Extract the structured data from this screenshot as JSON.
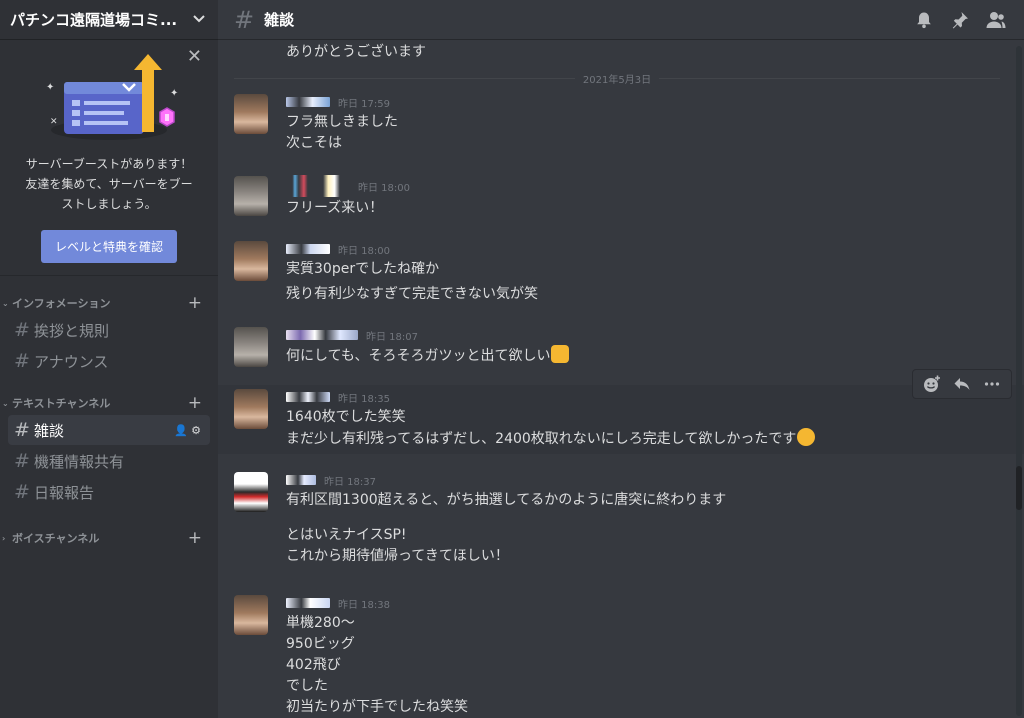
{
  "server": {
    "name": "パチンコ遠隔道場コミ..."
  },
  "boost": {
    "text_line1": "サーバーブーストがあります！",
    "text_line2": "友達を集めて、サーバーをブー",
    "text_line3": "ストしましょう。",
    "button_label": "レベルと特典を確認"
  },
  "categories": {
    "info": "インフォメーション",
    "text": "テキストチャンネル",
    "voice": "ボイスチャンネル"
  },
  "channels": {
    "greeting": "挨拶と規則",
    "announce": "アナウンス",
    "chat": "雑談",
    "machine": "機種情報共有",
    "daily": "日報報告"
  },
  "topbar": {
    "title": "雑談"
  },
  "colors": {
    "accent": "#7289da",
    "sidebar_bg": "#2f3136",
    "main_bg": "#36393f"
  },
  "icons": [
    "bell-icon",
    "pin-icon",
    "members-icon",
    "close-icon",
    "chevron-down-icon",
    "plus-icon",
    "add-member-icon",
    "gear-icon",
    "add-reaction-icon",
    "reply-icon",
    "more-icon"
  ],
  "messages": {
    "top_line": "ありがとうございます",
    "date_divider": "2021年5月3日",
    "m1": {
      "time": "昨日 17:59",
      "l1": "フラ無しきました",
      "l2": "次こそは"
    },
    "m2": {
      "time": "昨日 18:00",
      "l1": "フリーズ来い！"
    },
    "m3": {
      "time": "昨日 18:00",
      "l1": "実質30perでしたね確か",
      "l2": "残り有利少なすぎて完走できない気が笑"
    },
    "m4": {
      "time": "昨日 18:07",
      "l1": "何にしても、そろそろガツッと出て欲しい"
    },
    "m5": {
      "time": "昨日 18:35",
      "l1": "1640枚でした笑笑",
      "l2": "まだ少し有利残ってるはずだし、2400枚取れないにしろ完走して欲しかったです"
    },
    "m6": {
      "time": "昨日 18:37",
      "l1": "有利区間1300超えると、がち抽選してるかのように唐突に終わります",
      "l2": "とはいえナイスSP!",
      "l3": "これから期待値帰ってきてほしい！"
    },
    "m7": {
      "time": "昨日 18:38",
      "l1": "単機280〜",
      "l2": "950ビッグ",
      "l3": "402飛び",
      "l4": "でした",
      "l5": "初当たりが下手でしたね笑笑"
    }
  }
}
